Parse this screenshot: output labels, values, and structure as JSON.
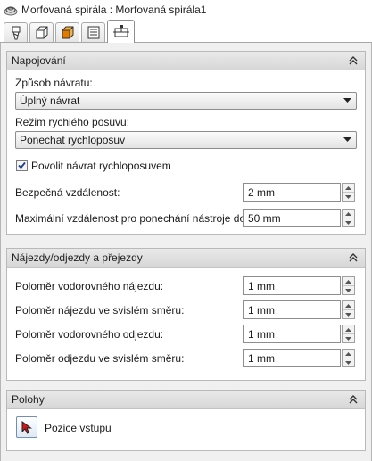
{
  "window": {
    "title": "Morfovaná spirála : Morfovaná spirála1",
    "title_icon": "spiral-icon"
  },
  "tabs": [
    {
      "icon": "tool-icon",
      "active": false
    },
    {
      "icon": "stock-cube-icon",
      "active": false
    },
    {
      "icon": "geometry-cube-icon",
      "active": false
    },
    {
      "icon": "parameters-icon",
      "active": false
    },
    {
      "icon": "linking-icon",
      "active": true
    }
  ],
  "sections": {
    "linking": {
      "title": "Napojování",
      "return_mode_label": "Způsob návratu:",
      "return_mode_value": "Úplný návrat",
      "rapid_mode_label": "Režim rychlého posuvu:",
      "rapid_mode_value": "Ponechat rychloposuv",
      "allow_rapid_return_label": "Povolit návrat rychloposuvem",
      "allow_rapid_return_checked": true,
      "safe_distance_label": "Bezpečná vzdálenost:",
      "safe_distance_value": "2 mm",
      "max_stay_down_label": "Maximální vzdálenost pro ponechání nástroje dole:",
      "max_stay_down_value": "50 mm"
    },
    "leads": {
      "title": "Nájezdy/odjezdy a přejezdy",
      "rows": [
        {
          "label": "Poloměr vodorovného nájezdu:",
          "value": "1 mm"
        },
        {
          "label": "Poloměr nájezdu ve svislém směru:",
          "value": "1 mm"
        },
        {
          "label": "Poloměr vodorovného odjezdu:",
          "value": "1 mm"
        },
        {
          "label": "Poloměr odjezdu ve svislém směru:",
          "value": "1 mm"
        }
      ]
    },
    "positions": {
      "title": "Polohy",
      "entry_position_label": "Pozice vstupu"
    }
  },
  "colors": {
    "accent": "#e07a00",
    "pointer_red": "#d01818",
    "header_bg": "#dcdcdc"
  }
}
